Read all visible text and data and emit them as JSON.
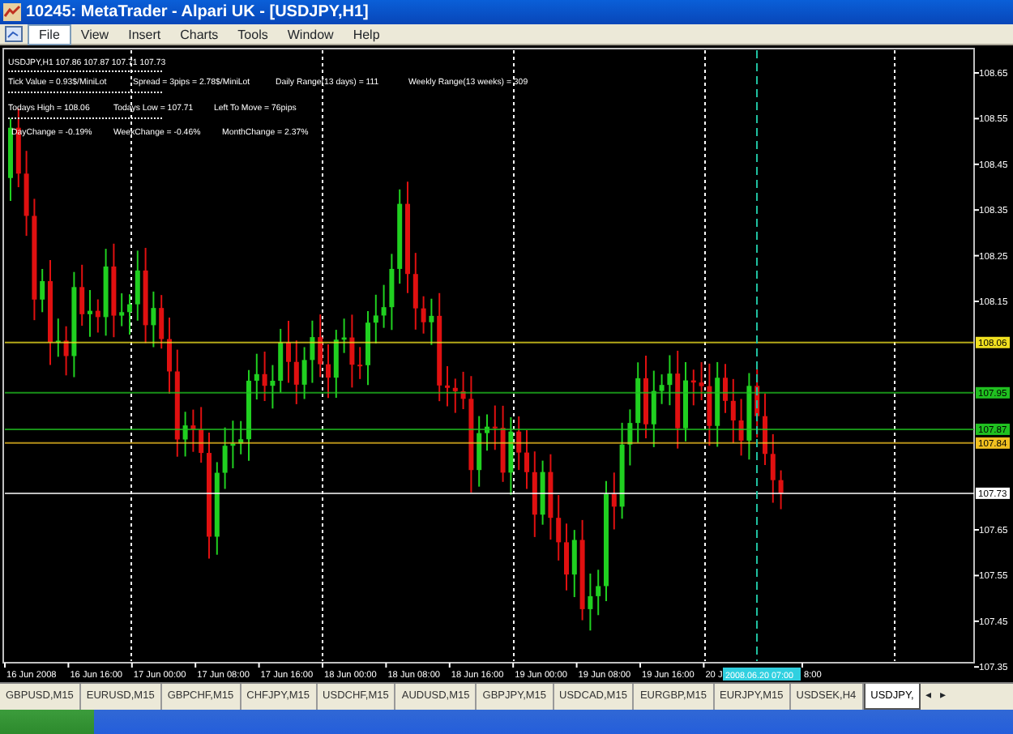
{
  "window": {
    "title": "10245: MetaTrader - Alpari UK - [USDJPY,H1]"
  },
  "menu": [
    {
      "label": "File",
      "selected": true
    },
    {
      "label": "View",
      "selected": false
    },
    {
      "label": "Insert",
      "selected": false
    },
    {
      "label": "Charts",
      "selected": false
    },
    {
      "label": "Tools",
      "selected": false
    },
    {
      "label": "Window",
      "selected": false
    },
    {
      "label": "Help",
      "selected": false
    }
  ],
  "chart": {
    "symbol_line": "USDJPY,H1  107.86 107.87 107.71 107.73",
    "info_rows": [
      [
        "Tick Value = 0.93$/MiniLot",
        "Spread = 3pips = 2.78$/MiniLot",
        "Daily Range(13 days) = 111",
        "Weekly Range(13 weeks) = 309"
      ],
      [
        "Todays High = 108.06",
        "Todays Low = 107.71",
        "Left To Move = 76pips"
      ],
      [
        "DayChange = -0.19%",
        "WeekChange = -0.46%",
        "MonthChange = 2.37%"
      ]
    ],
    "price_ticks": [
      "108.65",
      "108.55",
      "108.45",
      "108.35",
      "108.25",
      "108.15",
      "107.65",
      "107.55",
      "107.45",
      "107.35"
    ],
    "price_lines": [
      {
        "label": "108.06",
        "color": "#f0e020"
      },
      {
        "label": "107.95",
        "color": "#20c020"
      },
      {
        "label": "107.87",
        "color": "#20c020"
      },
      {
        "label": "107.84",
        "color": "#f0c020"
      },
      {
        "label": "107.73",
        "color": "#ffffff"
      }
    ],
    "time_labels": [
      "16 Jun 2008",
      "16 Jun 16:00",
      "17 Jun 00:00",
      "17 Jun 08:00",
      "17 Jun 16:00",
      "18 Jun 00:00",
      "18 Jun 08:00",
      "18 Jun 16:00",
      "19 Jun 00:00",
      "19 Jun 08:00",
      "19 Jun 16:00",
      "20 J",
      "8:00"
    ],
    "cursor_time": "2008.06.20 07:00"
  },
  "tabs": [
    {
      "label": "GBPUSD,M15",
      "selected": false
    },
    {
      "label": "EURUSD,M15",
      "selected": false
    },
    {
      "label": "GBPCHF,M15",
      "selected": false
    },
    {
      "label": "CHFJPY,M15",
      "selected": false
    },
    {
      "label": "USDCHF,M15",
      "selected": false
    },
    {
      "label": "AUDUSD,M15",
      "selected": false
    },
    {
      "label": "GBPJPY,M15",
      "selected": false
    },
    {
      "label": "USDCAD,M15",
      "selected": false
    },
    {
      "label": "EURGBP,M15",
      "selected": false
    },
    {
      "label": "EURJPY,M15",
      "selected": false
    },
    {
      "label": "USDSEK,H4",
      "selected": false
    },
    {
      "label": "USDJPY,",
      "selected": true
    }
  ],
  "tab_scroll": [
    "◂",
    "▸"
  ]
}
